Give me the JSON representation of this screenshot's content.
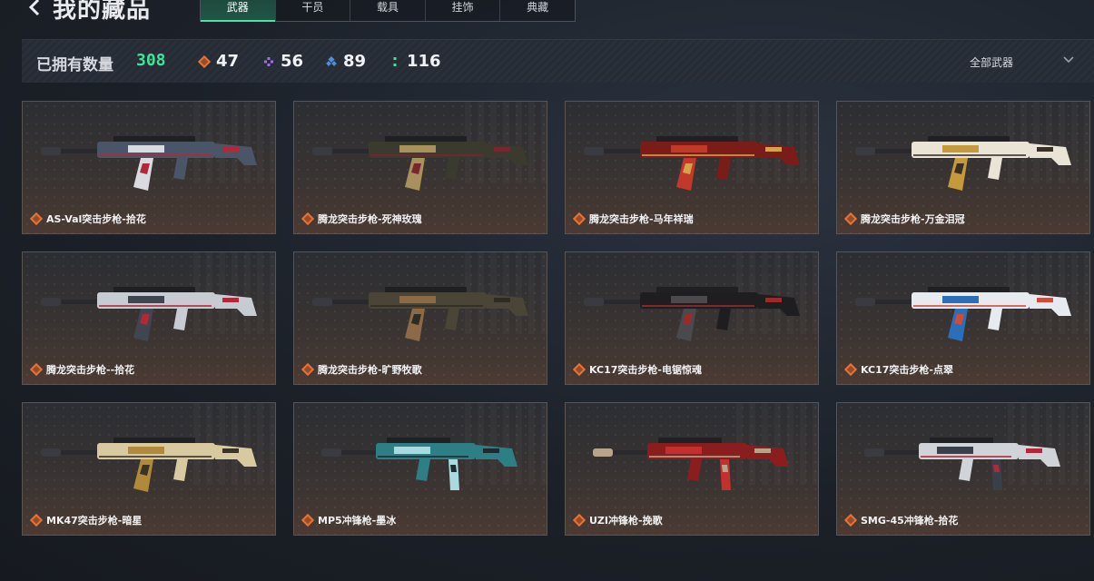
{
  "header": {
    "title": "我的藏品",
    "tabs": [
      {
        "label": "武器",
        "active": true
      },
      {
        "label": "干员",
        "active": false
      },
      {
        "label": "载具",
        "active": false
      },
      {
        "label": "挂饰",
        "active": false
      },
      {
        "label": "典藏",
        "active": false
      }
    ]
  },
  "stats": {
    "owned_label": "已拥有数量",
    "owned_count": "308",
    "rarities": [
      {
        "icon": "orange-diamond-icon",
        "count": "47",
        "color": "#e2733a"
      },
      {
        "icon": "purple-diamond-icon",
        "count": "56",
        "color": "#a56ae6"
      },
      {
        "icon": "blue-diamond-icon",
        "count": "89",
        "color": "#4f8fe0"
      },
      {
        "icon": "green-dots-icon",
        "count": "116",
        "color": "#3fe39a"
      }
    ],
    "filter_value": "全部武器"
  },
  "items": [
    {
      "name": "AS-Val突击步枪-拾花",
      "palette": [
        "#4a5668",
        "#d8dce0",
        "#b2283a"
      ]
    },
    {
      "name": "腾龙突击步枪-死神玫瑰",
      "palette": [
        "#3b3a2f",
        "#a8915a",
        "#7a2630"
      ]
    },
    {
      "name": "腾龙突击步枪-马年祥瑞",
      "palette": [
        "#7a1c18",
        "#c0392b",
        "#d9a04a"
      ]
    },
    {
      "name": "腾龙突击步枪-万金泪冠",
      "palette": [
        "#e9e4d6",
        "#c59a3a",
        "#3b3026"
      ]
    },
    {
      "name": "腾龙突击步枪--拾花",
      "palette": [
        "#c7ccd2",
        "#3f4650",
        "#b2283a"
      ]
    },
    {
      "name": "腾龙突击步枪-旷野牧歌",
      "palette": [
        "#4a4536",
        "#8b6a45",
        "#2e2b24"
      ]
    },
    {
      "name": "KC17突击步枪-电锯惊魂",
      "palette": [
        "#1e1e20",
        "#4a4a4e",
        "#9b2a2a"
      ]
    },
    {
      "name": "KC17突击步枪-点翠",
      "palette": [
        "#e7ebef",
        "#2a6fb8",
        "#cf4b3a"
      ]
    },
    {
      "name": "MK47突击步枪-暗星",
      "palette": [
        "#d8c9a0",
        "#b08a3a",
        "#3a3326"
      ]
    },
    {
      "name": "MP5冲锋枪-墨冰",
      "palette": [
        "#2e7e86",
        "#a7dbe0",
        "#1d2b30"
      ]
    },
    {
      "name": "UZI冲锋枪-挽歌",
      "palette": [
        "#8a1e1e",
        "#c23030",
        "#b8a48a"
      ]
    },
    {
      "name": "SMG-45冲锋枪-拾花",
      "palette": [
        "#d0d4d9",
        "#3a4049",
        "#b2283a"
      ]
    }
  ]
}
